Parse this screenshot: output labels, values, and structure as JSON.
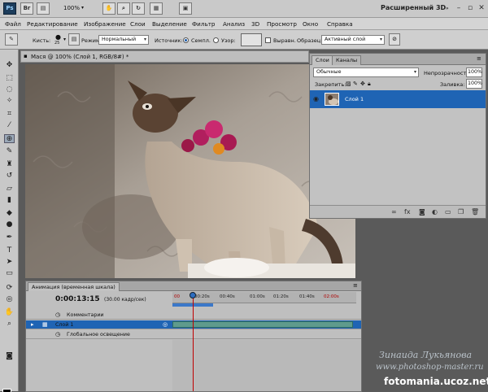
{
  "appbar": {
    "zoom": "100%",
    "workspace": "Расширенный 3D",
    "window_controls": [
      "minimize-icon",
      "restore-icon",
      "close-icon"
    ]
  },
  "menu": [
    "Файл",
    "Редактирование",
    "Изображение",
    "Слои",
    "Выделение",
    "Фильтр",
    "Анализ",
    "3D",
    "Просмотр",
    "Окно",
    "Справка"
  ],
  "options": {
    "brush_label": "Кисть:",
    "brush_size": "25",
    "mode_label": "Режим:",
    "mode_value": "Нормальный",
    "source_label": "Источник:",
    "sampled_label": "Семпл.",
    "pattern_label": "Узор:",
    "aligned_label": "Выравн.",
    "sample_label": "Образец:",
    "sample_value": "Активный слой"
  },
  "document": {
    "tab_title": "Мася @ 100% (Слой 1, RGB/8#) *"
  },
  "layers_panel": {
    "tabs": [
      "Слои",
      "Каналы"
    ],
    "blend_mode": "Обычные",
    "opacity_label": "Непрозрачность:",
    "opacity_value": "100%",
    "lock_label": "Закрепить:",
    "fill_label": "Заливка:",
    "fill_value": "100%",
    "layer_name": "Слой 1"
  },
  "animation_panel": {
    "title": "Анимация (временная шкала)",
    "timecode": "0:00:13:15",
    "fps": "(30.00 кадр/сек)",
    "ruler": [
      "00",
      "00:20s",
      "00:40s",
      "01:00s",
      "01:20s",
      "01:40s",
      "02:00s"
    ],
    "tracks": {
      "comments": "Комментарии",
      "layer": "Слой 1",
      "global_light": "Глобальное освещение"
    }
  },
  "watermark": {
    "signature": "Зинаида Лукьянова",
    "site_small": "www.photoshop-master.ru",
    "site_big": "fotomania.ucoz.net"
  },
  "colors": {
    "selection": "#1f64b4",
    "layer_bar": "#5f9b8d",
    "playhead": "#c00000"
  }
}
